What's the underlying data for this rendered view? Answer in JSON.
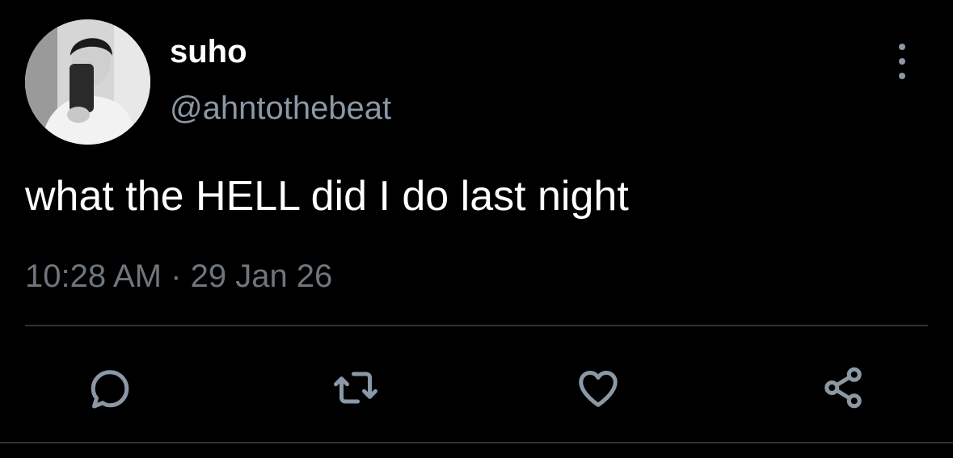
{
  "user": {
    "display_name": "suho",
    "handle": "@ahntothebeat"
  },
  "tweet": {
    "text": "what the HELL did I do last night",
    "time": "10:28 AM",
    "separator": "·",
    "date": "29 Jan 26"
  },
  "actions": {
    "reply_icon": "reply-icon",
    "retweet_icon": "retweet-icon",
    "like_icon": "heart-icon",
    "share_icon": "share-icon",
    "more_icon": "more-vertical-icon"
  },
  "colors": {
    "background": "#000000",
    "primary_text": "#ffffff",
    "secondary_text": "#8b98a5",
    "meta_text": "#6e767d",
    "divider": "#2f3336"
  }
}
